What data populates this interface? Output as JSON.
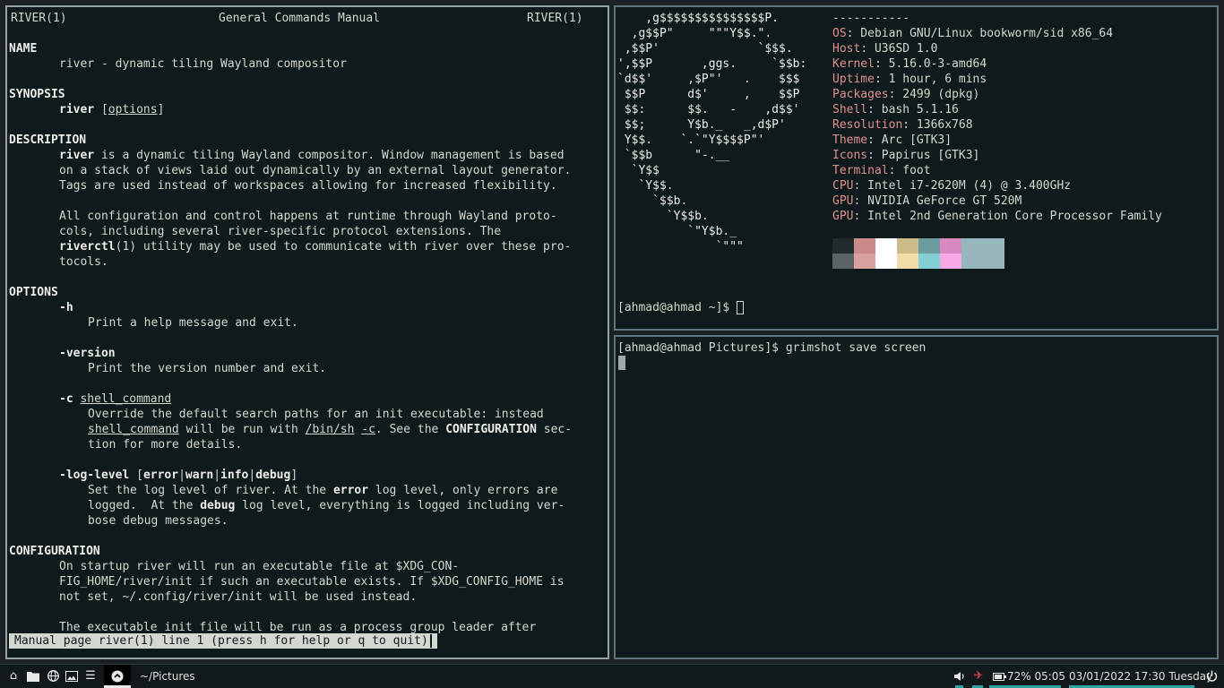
{
  "man": {
    "header_left": "RIVER(1)",
    "header_center": "General Commands Manual",
    "header_right": "RIVER(1)",
    "name_heading": "NAME",
    "name_text": "river - dynamic tiling Wayland compositor",
    "synopsis_heading": "SYNOPSIS",
    "synopsis_cmd": "river",
    "synopsis_open": "[",
    "synopsis_arg": "options",
    "synopsis_close": "]",
    "description_heading": "DESCRIPTION",
    "desc1_cmd": "river",
    "desc1_rest": " is a dynamic tiling Wayland compositor. Window management is based",
    "desc2": "on a stack of views laid out dynamically by an external layout generator.",
    "desc3": "Tags are used instead of workspaces allowing for increased flexibility.",
    "desc4": "All configuration and control happens at runtime through Wayland proto-",
    "desc5": "cols, including several river-specific protocol extensions. The",
    "desc6_cmd": "riverctl",
    "desc6_rest": "(1) utility may be used to communicate with river over these pro-",
    "desc7": "tocols.",
    "options_heading": "OPTIONS",
    "opt_h": "-h",
    "opt_h_desc": "Print a help message and exit.",
    "opt_version": "-version",
    "opt_version_desc": "Print the version number and exit.",
    "opt_c": "-c",
    "opt_c_arg": "shell_command",
    "opt_c_desc1": "Override the default search paths for an init executable: instead",
    "opt_c_desc2_arg": "shell_command",
    "opt_c_desc2_mid": " will be run with ",
    "opt_c_desc2_binsh": "/bin/sh",
    "opt_c_desc2_space": " ",
    "opt_c_desc2_c": "-c",
    "opt_c_desc2_see": ". See the ",
    "opt_c_desc2_config": "CONFIGURATION",
    "opt_c_desc2_end": " sec-",
    "opt_c_desc3": "tion for more details.",
    "opt_log": "-log-level",
    "opt_log_open": " [",
    "opt_log_error": "error",
    "opt_log_sep1": "|",
    "opt_log_warn": "warn",
    "opt_log_sep2": "|",
    "opt_log_info": "info",
    "opt_log_sep3": "|",
    "opt_log_debug": "debug",
    "opt_log_close": "]",
    "opt_log_desc1_a": "Set the log level of river. At the ",
    "opt_log_desc1_b": "error",
    "opt_log_desc1_c": " log level, only errors are",
    "opt_log_desc2_a": "logged.  At the ",
    "opt_log_desc2_b": "debug",
    "opt_log_desc2_c": " log level, everything is logged including ver-",
    "opt_log_desc3": "bose debug messages.",
    "config_heading": "CONFIGURATION",
    "config1": "On startup river will run an executable file at $XDG_CON-",
    "config2": "FIG_HOME/river/init if such an executable exists. If $XDG_CONFIG_HOME is",
    "config3": "not set, ~/.config/river/init will be used instead.",
    "config4": "The executable init file will be run as a process group leader after",
    "status": "Manual page river(1) line 1 (press h for help or q to quit)"
  },
  "fetch": {
    "ascii": [
      "    ,g$$$$$$$$$$$$$$$P.",
      "  ,g$$P\"     \"\"\"Y$$.\".",
      " ,$$P'              `$$$.",
      "',$$P       ,ggs.     `$$b:",
      "`d$$'     ,$P\"'   .    $$$",
      " $$P      d$'     ,    $$P",
      " $$:      $$.   -    ,d$$'",
      " $$;      Y$b._   _,d$P'",
      " Y$$.    `.`\"Y$$$$P\"'",
      " `$$b      \"-.__",
      "  `Y$$",
      "   `Y$$.",
      "     `$$b.",
      "       `Y$$b.",
      "          `\"Y$b._",
      "              `\"\"\""
    ],
    "dashes": "-----------",
    "info": [
      {
        "label": "OS",
        "value": ": Debian GNU/Linux bookworm/sid x86_64"
      },
      {
        "label": "Host",
        "value": ": U36SD 1.0"
      },
      {
        "label": "Kernel",
        "value": ": 5.16.0-3-amd64"
      },
      {
        "label": "Uptime",
        "value": ": 1 hour, 6 mins"
      },
      {
        "label": "Packages",
        "value": ": 2499 (dpkg)"
      },
      {
        "label": "Shell",
        "value": ": bash 5.1.16"
      },
      {
        "label": "Resolution",
        "value": ": 1366x768"
      },
      {
        "label": "Theme",
        "value": ": Arc [GTK3]"
      },
      {
        "label": "Icons",
        "value": ": Papirus [GTK3]"
      },
      {
        "label": "Terminal",
        "value": ": foot"
      },
      {
        "label": "CPU",
        "value": ": Intel i7-2620M (4) @ 3.400GHz"
      },
      {
        "label": "GPU",
        "value": ": NVIDIA GeForce GT 520M"
      },
      {
        "label": "GPU",
        "value": ": Intel 2nd Generation Core Processor Family"
      }
    ],
    "palette_top": [
      "#232a2d",
      "#c98a8a",
      "#ffffff",
      "#cdbb8a",
      "#6b9ca0",
      "#d88ac0",
      "#96b8bd",
      "#96b8bd"
    ],
    "palette_bottom": [
      "#5c6366",
      "#d9a0a0",
      "#ffffff",
      "#f0dca8",
      "#84cfd3",
      "#f6a8e4",
      "#96b8bd",
      "#96b8bd"
    ],
    "prompt": "[ahmad@ahmad ~]$ "
  },
  "grim": {
    "prompt": "[ahmad@ahmad Pictures]$ ",
    "command": "grimshot save screen"
  },
  "taskbar": {
    "cwd": "~/Pictures",
    "battery": "72% 05:05",
    "datetime": "03/01/2022 17:30 Tuesday",
    "icons": {
      "home": "home-icon",
      "folder": "folder-icon",
      "globe": "globe-icon",
      "image": "image-icon",
      "menu": "menu-icon",
      "terminal": "terminal-icon",
      "volume": "volume-icon",
      "airplane": "airplane-mode-icon",
      "battery": "battery-icon",
      "power": "power-icon"
    }
  }
}
